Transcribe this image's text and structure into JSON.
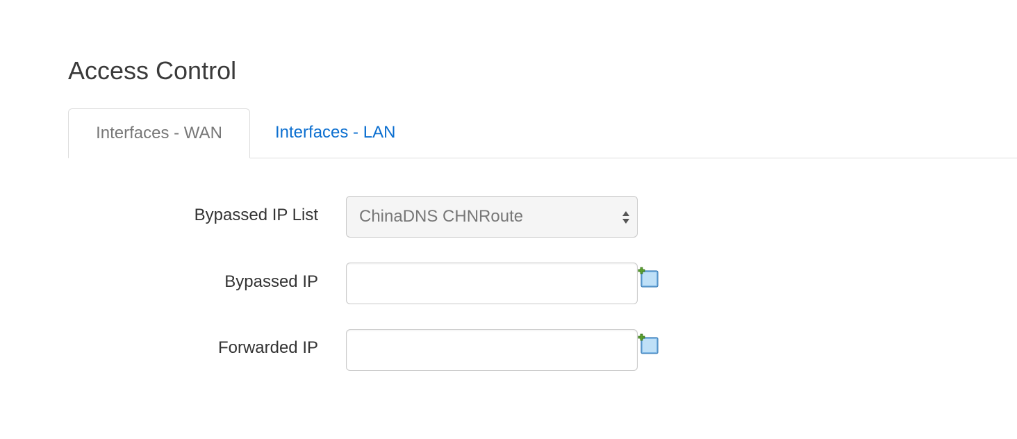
{
  "section": {
    "title": "Access Control"
  },
  "tabs": [
    {
      "label": "Interfaces - WAN",
      "active": true
    },
    {
      "label": "Interfaces - LAN",
      "active": false
    }
  ],
  "form": {
    "bypassed_ip_list": {
      "label": "Bypassed IP List",
      "selected": "ChinaDNS CHNRoute",
      "icon": "select-updown-icon"
    },
    "bypassed_ip": {
      "label": "Bypassed IP",
      "value": "",
      "add_icon": "add-entry-icon"
    },
    "forwarded_ip": {
      "label": "Forwarded IP",
      "value": "",
      "add_icon": "add-entry-icon"
    }
  },
  "colors": {
    "link": "#0c6fd0",
    "active_tab_text": "#777777",
    "border": "#c8c8c8",
    "add_icon_green": "#5aa02c",
    "add_icon_blue": "#7fb8e6"
  }
}
